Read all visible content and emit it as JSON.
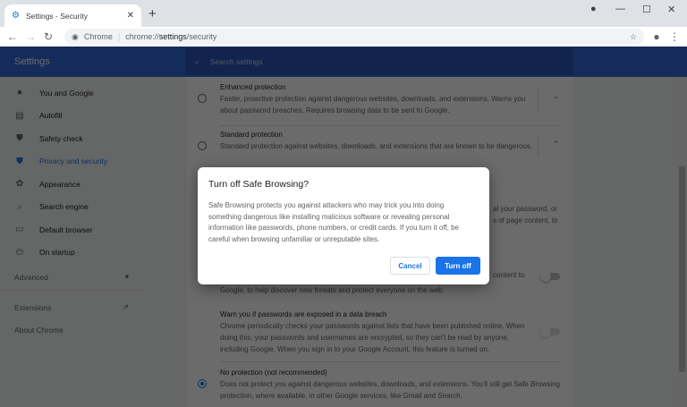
{
  "browser": {
    "tab_title": "Settings - Security",
    "chip": "Chrome",
    "url_prefix": "chrome://",
    "url_bold": "settings",
    "url_suffix": "/security"
  },
  "header": {
    "title": "Settings",
    "search_placeholder": "Search settings"
  },
  "sidebar": {
    "items": [
      {
        "label": "You and Google",
        "icon": "person-icon"
      },
      {
        "label": "Autofill",
        "icon": "clipboard-icon"
      },
      {
        "label": "Safety check",
        "icon": "shield-check-icon"
      },
      {
        "label": "Privacy and security",
        "icon": "shield-icon",
        "active": true
      },
      {
        "label": "Appearance",
        "icon": "palette-icon"
      },
      {
        "label": "Search engine",
        "icon": "search-icon"
      },
      {
        "label": "Default browser",
        "icon": "browser-icon"
      },
      {
        "label": "On startup",
        "icon": "power-icon"
      }
    ],
    "advanced": "Advanced",
    "extensions": "Extensions",
    "about": "About Chrome"
  },
  "content": {
    "enhanced": {
      "title": "Enhanced protection",
      "desc": "Faster, proactive protection against dangerous websites, downloads, and extensions. Warns you about password breaches. Requires browsing data to be sent to Google."
    },
    "standard": {
      "title": "Standard protection",
      "desc": "Standard protection against websites, downloads, and extensions that are known to be dangerous."
    },
    "frag1": "al your password, or",
    "frag2": "s of page content, to",
    "frag3": "content to",
    "frag4": "Google, to help discover new threats and protect everyone on the web.",
    "breach": {
      "title": "Warn you if passwords are exposed in a data breach",
      "desc": "Chrome periodically checks your passwords against lists that have been published online. When doing this, your passwords and usernames are encrypted, so they can't be read by anyone, including Google. When you sign in to your Google Account, this feature is turned on."
    },
    "none": {
      "title": "No protection (not recommended)",
      "desc": "Does not protect you against dangerous websites, downloads, and extensions. You'll still get Safe Browsing protection, where available, in other Google services, like Gmail and Search."
    }
  },
  "dialog": {
    "title": "Turn off Safe Browsing?",
    "body": "Safe Browsing protects you against attackers who may trick you into doing something dangerous like installing malicious software or revealing personal information like passwords, phone numbers, or credit cards. If you turn it off, be careful when browsing unfamiliar or unreputable sites.",
    "cancel": "Cancel",
    "confirm": "Turn off"
  },
  "colors": {
    "accent": "#1a73e8",
    "header": "#3367d6"
  }
}
